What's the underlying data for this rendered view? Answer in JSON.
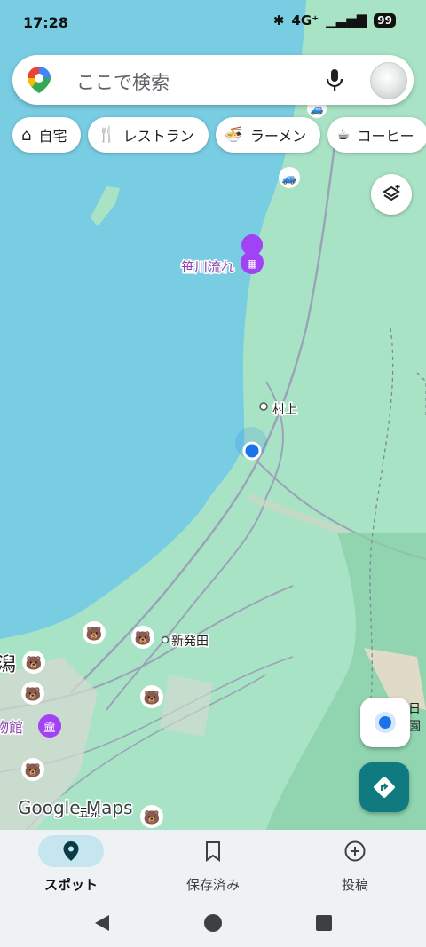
{
  "status_bar": {
    "time": "17:28",
    "network": "4G⁺",
    "battery": "99"
  },
  "search": {
    "placeholder": "ここで検索"
  },
  "chips": [
    {
      "label": "自宅",
      "icon": "home-icon"
    },
    {
      "label": "レストラン",
      "icon": "fork-knife-icon"
    },
    {
      "label": "ラーメン",
      "icon": "ramen-bowl-icon"
    },
    {
      "label": "コーヒー",
      "icon": "coffee-cup-icon"
    }
  ],
  "map": {
    "places": [
      {
        "label": "笹川流れ"
      },
      {
        "label": "村上"
      },
      {
        "label": "新発田"
      },
      {
        "label": "潟"
      },
      {
        "label": "物館"
      },
      {
        "label": "五泉"
      },
      {
        "label": "日"
      },
      {
        "label": "園"
      }
    ],
    "logo": "Google Maps",
    "colors": {
      "sea": "#79cde3",
      "land": "#a9e3c6",
      "road": "#9aa3b8",
      "brand": "#0f7b81",
      "location": "#1a73e8"
    }
  },
  "nav": {
    "items": [
      {
        "label": "スポット",
        "icon": "location-pin-icon",
        "active": true
      },
      {
        "label": "保存済み",
        "icon": "bookmark-icon",
        "active": false
      },
      {
        "label": "投稿",
        "icon": "add-circle-icon",
        "active": false
      }
    ]
  }
}
